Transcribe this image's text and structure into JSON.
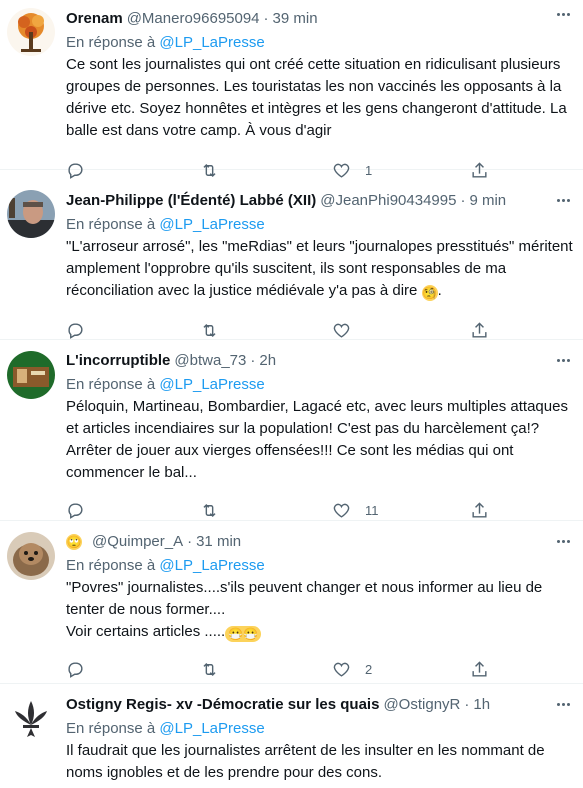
{
  "tweets": [
    {
      "name": "Orenam",
      "handle": "@Manero96695094",
      "time": "39 min",
      "reply_prefix": "En réponse à",
      "reply_to": "@LP_LaPresse",
      "text": "Ce sont les journalistes qui ont créé cette situation en ridiculisant plusieurs groupes de personnes. Les touristatas les non vaccinés les opposants à la dérive etc. Soyez honnêtes et intègres et les gens changeront d'attitude. La balle est dans votre camp. À vous d'agir",
      "likes": "1"
    },
    {
      "name": "Jean-Philippe (l'Édenté) Labbé (XII)",
      "handle": "@JeanPhi90434995",
      "time": "9 min",
      "reply_prefix": "En réponse à",
      "reply_to": "@LP_LaPresse",
      "text": "\"L'arroseur arrosé\", les \"meRdias\" et leurs \"journalopes presstitués\" méritent amplement l'opprobre qu'ils suscitent, ils sont responsables de ma réconciliation avec la justice médiévale y'a pas à dire",
      "emoji": "🧐",
      "text_end": ".",
      "likes": ""
    },
    {
      "name": "L'incorruptible",
      "handle": "@btwa_73",
      "time": "2h",
      "reply_prefix": "En réponse à",
      "reply_to": "@LP_LaPresse",
      "text": "Péloquin, Martineau, Bombardier, Lagacé etc, avec leurs multiples attaques et articles incendiaires sur la population! C'est pas du harcèlement ça!? Arrêter de jouer aux vierges offensées!!! Ce sont les médias qui ont commencer le bal...",
      "likes": "11"
    },
    {
      "name": "",
      "name_emoji": "🙄",
      "handle": "@Quimper_A",
      "time": "31 min",
      "reply_prefix": "En réponse à",
      "reply_to": "@LP_LaPresse",
      "text": "\"Povres\" journalistes....s'ils peuvent changer et nous informer au lieu de tenter de nous former....\nVoir certains articles .....",
      "emoji": "😷😷",
      "likes": "2"
    },
    {
      "name": "Ostigny Regis- xv -Démocratie sur les quais",
      "handle": "@OstignyR",
      "time": "1h",
      "reply_prefix": "En réponse à",
      "reply_to": "@LP_LaPresse",
      "text": "Il faudrait que les journalistes arrêtent de les insulter en les nommant de noms ignobles et de les prendre pour des cons."
    }
  ],
  "icons": {
    "reply": "reply-icon",
    "retweet": "retweet-icon",
    "like": "like-icon",
    "share": "share-icon",
    "more": "more-icon"
  },
  "colors": {
    "link": "#1d9bf0",
    "secondary": "#536471",
    "text": "#0f1419",
    "divider": "#eff3f4"
  }
}
